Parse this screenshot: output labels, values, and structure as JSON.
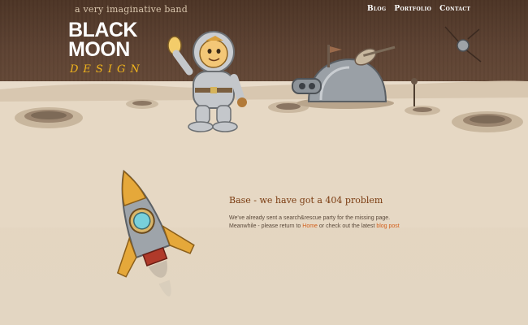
{
  "header": {
    "tagline": "a very imaginative band",
    "logo": {
      "line1": "BLACK",
      "line2": "MOON",
      "line3": "DESIGN"
    },
    "nav": [
      {
        "label": "Blog"
      },
      {
        "label": "Portfolio"
      },
      {
        "label": "Contact"
      }
    ]
  },
  "content": {
    "headline": "Base - we have got a 404 problem",
    "line1": "We've already sent a search&rescue party for the missing page.",
    "line2_prefix": "Meanwhile - please return to ",
    "home_link": "Home",
    "line2_middle": " or check out the latest ",
    "blog_link": "blog post"
  },
  "colors": {
    "sky": "#4d3526",
    "ground": "#e6d9c4",
    "accent": "#f1b51c",
    "link": "#d25f1b",
    "headline": "#7a3b10"
  }
}
